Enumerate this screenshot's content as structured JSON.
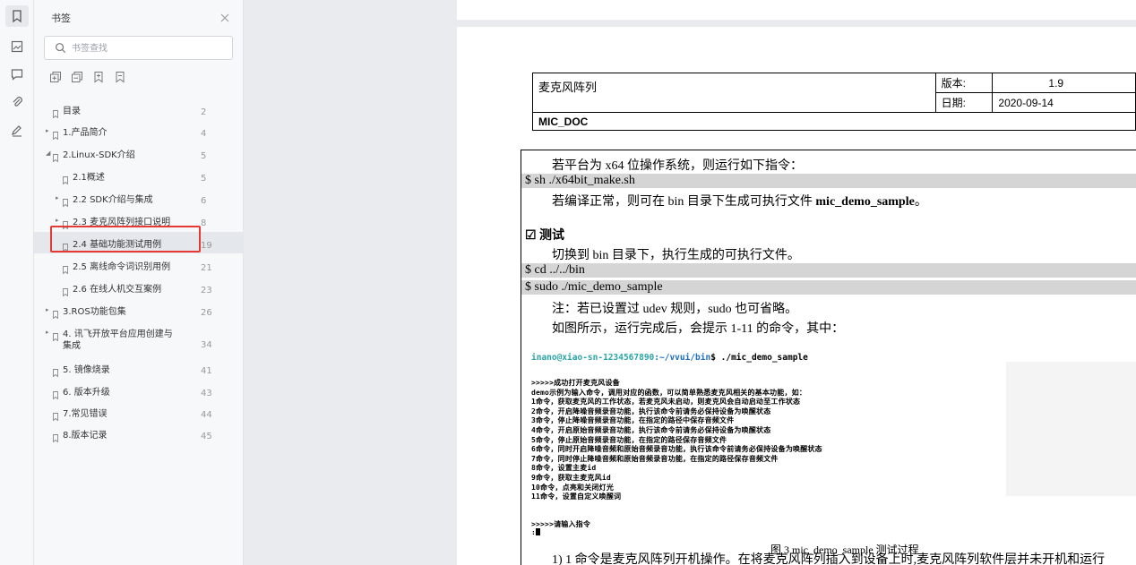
{
  "panel": {
    "title": "书签",
    "search_placeholder": "书签查找",
    "toolbar": [
      "expand-all-icon",
      "collapse-all-icon",
      "add-bookmark-icon",
      "delete-bookmark-icon"
    ]
  },
  "bookmarks": [
    {
      "label": "目录",
      "page": "2"
    },
    {
      "label": "1.产品简介",
      "page": "4"
    },
    {
      "label": "2.Linux-SDK介绍",
      "page": "5"
    },
    {
      "label": "2.1概述",
      "page": "5"
    },
    {
      "label": "2.2 SDK介绍与集成",
      "page": "6"
    },
    {
      "label": "2.3 麦克风阵列接口说明",
      "page": "8"
    },
    {
      "label": "2.4 基础功能测试用例",
      "page": "19"
    },
    {
      "label": "2.5 离线命令词识别用例",
      "page": "21"
    },
    {
      "label": "2.6 在线人机交互案例",
      "page": "23"
    },
    {
      "label": "3.ROS功能包集",
      "page": "26"
    },
    {
      "label": "4. 讯飞开放平台应用创建与",
      "label2": "集成",
      "page": "34"
    },
    {
      "label": "5. 镜像烧录",
      "page": "41"
    },
    {
      "label": "6. 版本升级",
      "page": "43"
    },
    {
      "label": "7.常见错误",
      "page": "44"
    },
    {
      "label": "8.版本记录",
      "page": "45"
    }
  ],
  "doc": {
    "header": {
      "title": "麦克风阵列",
      "version_label": "版本:",
      "version": "1.9",
      "date_label": "日期:",
      "date": "2020-09-14",
      "doc_id": "MIC_DOC"
    },
    "lines": {
      "l1": "若平台为 x64 位操作系统，则运行如下指令：",
      "cmd1": "$ sh ./x64bit_make.sh",
      "l2a": "若编译正常，则可在 bin 目录下生成可执行文件 ",
      "l2b": "mic_demo_sample",
      "l2c": "。",
      "heading": "☑ 测试",
      "l3": "切换到 bin 目录下，执行生成的可执行文件。",
      "cmd2": "$ cd ../../bin",
      "cmd3": "$ sudo ./mic_demo_sample",
      "l4": "注：若已设置过 udev 规则，sudo 也可省略。",
      "l5": "如图所示，运行完成后，会提示 1-11 的命令，其中：",
      "l6": "1) 1 命令是麦克风阵列开机操作。在将麦克风阵列插入到设备上时,麦克风阵列软件层并未开机和运行"
    },
    "terminal": {
      "user": "inano@xiao-sn-1234567890",
      "path": ":~/vvui/bin",
      "cmd": "$ ./mic_demo_sample",
      "out": [
        ">>>>>成功打开麦克风设备",
        "demo示例为输入命令，调用对应的函数，可以简单熟悉麦克风相关的基本功能，如：",
        "1命令，获取麦克风的工作状态，若麦克风未启动，则麦克风会自动启动至工作状态",
        "2命令，开启降噪音频录音功能，执行该命令前请务必保持设备为唤醒状态",
        "3命令，停止降噪音频录音功能，在指定的路径中保存音频文件",
        "4命令，开启原始音频录音功能，执行该命令前请务必保持设备为唤醒状态",
        "5命令，停止原始音频录音功能，在指定的路径保存音频文件",
        "6命令，同时开启降噪音频和原始音频录音功能，执行该命令前请务必保持设备为唤醒状态",
        "7命令，同时停止降噪音频和原始音频录音功能，在指定的路径保存音频文件",
        "8命令，设置主麦id",
        "9命令，获取主麦克风id",
        "10命令，点亮和关闭灯光",
        "11命令，设置自定义唤醒词"
      ],
      "prompt2": ">>>>>请输入指令",
      "prompt3": ":"
    },
    "caption": "图 3 mic_demo_sample 测试过程"
  }
}
